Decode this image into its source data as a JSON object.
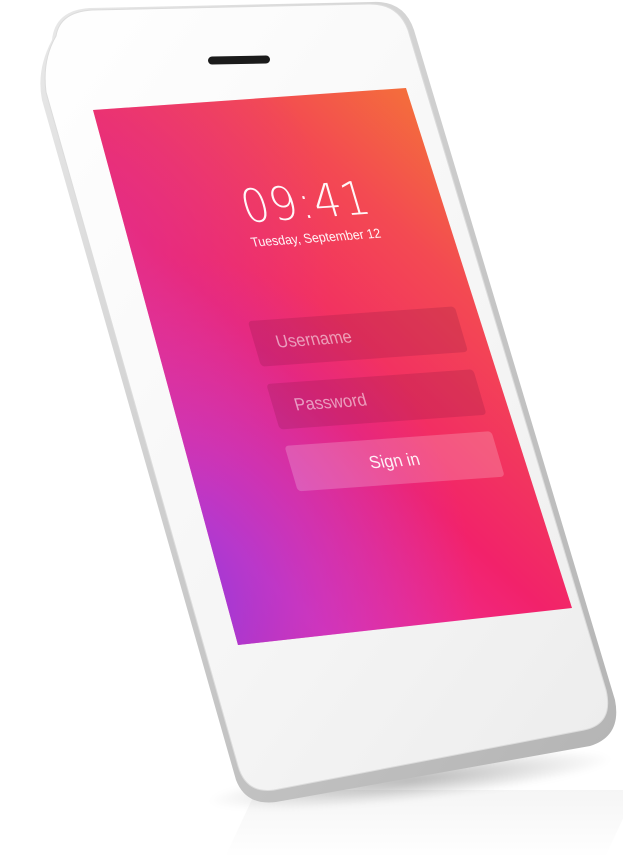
{
  "lock_screen": {
    "time": "09:41",
    "date": "Tuesday, September 12"
  },
  "login_form": {
    "username_placeholder": "Username",
    "password_placeholder": "Password",
    "sign_in_label": "Sign in"
  },
  "colors": {
    "gradient_orange": "#f4892a",
    "gradient_pink": "#f2226a",
    "gradient_magenta": "#ee2fa6",
    "gradient_purple": "#8a3ce6",
    "phone_body": "#f4f4f4",
    "phone_frame": "#d4d4d4"
  }
}
